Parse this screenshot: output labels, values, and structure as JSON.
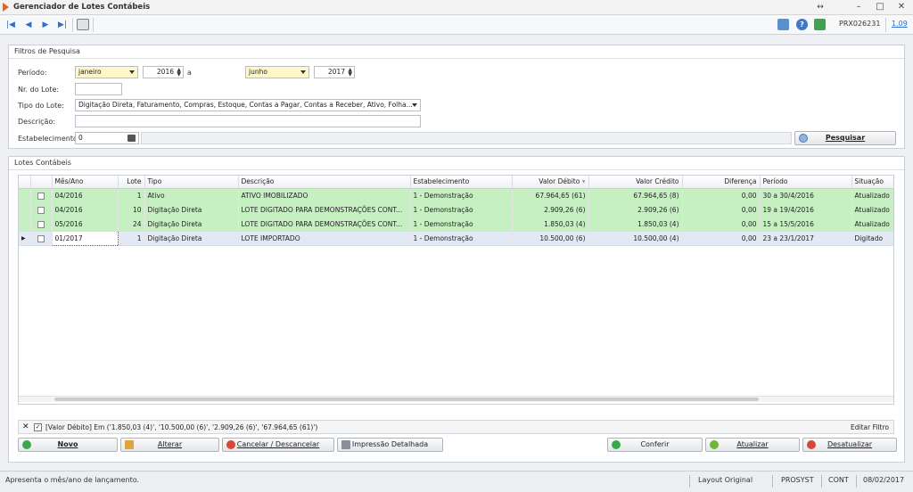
{
  "window": {
    "title": "Gerenciador de Lotes Contábeis"
  },
  "toolbar": {
    "user": "PRX026231",
    "version": "1.09"
  },
  "filters": {
    "title": "Filtros de Pesquisa",
    "periodo_label": "Período:",
    "periodo_from_month": "janeiro",
    "periodo_from_year": "2016",
    "periodo_sep": "a",
    "periodo_to_month": "junho",
    "periodo_to_year": "2017",
    "nr_lote_label": "Nr. do Lote:",
    "nr_lote_value": "",
    "tipo_label": "Tipo do Lote:",
    "tipo_value": "Digitação Direta, Faturamento, Compras, Estoque, Contas a Pagar, Contas a Receber, Ativo, Folha...",
    "descricao_label": "Descrição:",
    "descricao_value": "",
    "estab_label": "Estabelecimento:",
    "estab_value": "0",
    "search_label": "Pesquisar"
  },
  "lotes": {
    "title": "Lotes Contábeis",
    "columns": [
      "Mês/Ano",
      "Lote",
      "Tipo",
      "Descrição",
      "Estabelecimento",
      "Valor Débito",
      "Valor Crédito",
      "Diferença",
      "Período",
      "Situação"
    ],
    "rows": [
      {
        "mes": "04/2016",
        "lote": "1",
        "tipo": "Ativo",
        "desc": "ATIVO IMOBILIZADO",
        "estab": "1 - Demonstração",
        "deb": "67.964,65 (61)",
        "cred": "67.964,65 (8)",
        "dif": "0,00",
        "periodo": "30 a 30/4/2016",
        "sit": "Atualizado"
      },
      {
        "mes": "04/2016",
        "lote": "10",
        "tipo": "Digitação Direta",
        "desc": "LOTE DIGITADO PARA DEMONSTRAÇÕES CONT...",
        "estab": "1 - Demonstração",
        "deb": "2.909,26 (6)",
        "cred": "2.909,26 (6)",
        "dif": "0,00",
        "periodo": "19 a 19/4/2016",
        "sit": "Atualizado"
      },
      {
        "mes": "05/2016",
        "lote": "24",
        "tipo": "Digitação Direta",
        "desc": "LOTE DIGITADO PARA DEMONSTRAÇÕES CONT...",
        "estab": "1 - Demonstração",
        "deb": "1.850,03 (4)",
        "cred": "1.850,03 (4)",
        "dif": "0,00",
        "periodo": "15 a 15/5/2016",
        "sit": "Atualizado"
      },
      {
        "mes": "01/2017",
        "lote": "1",
        "tipo": "Digitação Direta",
        "desc": "LOTE IMPORTADO",
        "estab": "1 - Demonstração",
        "deb": "10.500,00 (6)",
        "cred": "10.500,00 (4)",
        "dif": "0,00",
        "periodo": "23 a 23/1/2017",
        "sit": "Digitado"
      }
    ],
    "filter_text": "[Valor Débito] Em ('1.850,03 (4)', '10.500,00 (6)', '2.909,26 (6)', '67.964,65 (61)')",
    "edit_filter": "Editar Filtro"
  },
  "buttons": {
    "novo": "Novo",
    "alterar": "Alterar",
    "cancelar": "Cancelar / Descancelar",
    "impressao": "Impressão Detalhada",
    "conferir": "Conferir",
    "atualizar": "Atualizar",
    "desatualizar": "Desatualizar"
  },
  "status": {
    "hint": "Apresenta o mês/ano de lançamento.",
    "layout": "Layout Original",
    "company": "PROSYST",
    "module": "CONT",
    "date": "08/02/2017"
  },
  "colors": {
    "accent": "#e8641e",
    "row_green": "#c6f0c2",
    "row_selected": "#e3e8f5",
    "nav_blue": "#2c6fcf"
  }
}
